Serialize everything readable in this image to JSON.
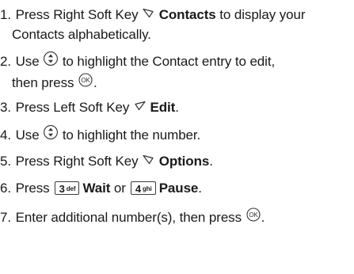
{
  "steps": [
    {
      "num": "1.",
      "a": "Press Right Soft Key",
      "icon": "right-soft-key-icon",
      "bold": "Contacts",
      "b": "to display your",
      "cont": "Contacts alphabetically."
    },
    {
      "num": "2.",
      "a": "Use",
      "icon": "navigation-key-icon",
      "b": "to highlight the Contact entry to edit,",
      "cont": "then press",
      "icon2": "ok-key-icon",
      "end": "."
    },
    {
      "num": "3.",
      "a": "Press Left Soft Key",
      "icon": "left-soft-key-icon",
      "bold": "Edit",
      "end": "."
    },
    {
      "num": "4.",
      "a": "Use",
      "icon": "navigation-key-icon",
      "b": "to highlight the number."
    },
    {
      "num": "5.",
      "a": "Press Right Soft Key",
      "icon": "right-soft-key-icon",
      "bold": "Options",
      "end": "."
    },
    {
      "num": "6.",
      "a": "Press",
      "key1": {
        "digit": "3",
        "letters": "def"
      },
      "bold1": "Wait",
      "or": "or",
      "key2": {
        "digit": "4",
        "letters": "ghi"
      },
      "bold2": "Pause",
      "end": "."
    },
    {
      "num": "7.",
      "a": "Enter additional number(s), then press",
      "icon": "ok-key-icon",
      "end": "."
    }
  ]
}
